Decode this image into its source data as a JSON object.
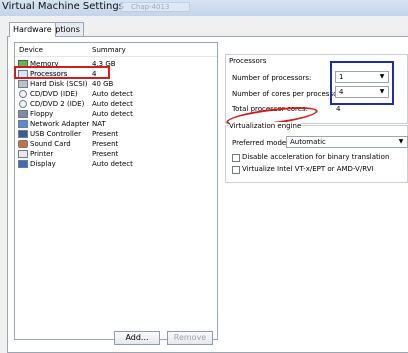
{
  "window": {
    "title": "Virtual Machine Settings",
    "background_tab": "Chap-4013"
  },
  "tabs": [
    "Hardware",
    "Options"
  ],
  "device_list": {
    "headers": [
      "Device",
      "Summary"
    ],
    "rows": [
      {
        "name": "Memory",
        "summary": "4.3 GB",
        "icon": "memory-icon"
      },
      {
        "name": "Processors",
        "summary": "4",
        "icon": "processor-icon"
      },
      {
        "name": "Hard Disk (SCSI)",
        "summary": "40 GB",
        "icon": "hard-disk-icon"
      },
      {
        "name": "CD/DVD (IDE)",
        "summary": "Auto detect",
        "icon": "cd-dvd-icon"
      },
      {
        "name": "CD/DVD 2 (IDE)",
        "summary": "Auto detect",
        "icon": "cd-dvd-icon"
      },
      {
        "name": "Floppy",
        "summary": "Auto detect",
        "icon": "floppy-icon"
      },
      {
        "name": "Network Adapter",
        "summary": "NAT",
        "icon": "network-adapter-icon"
      },
      {
        "name": "USB Controller",
        "summary": "Present",
        "icon": "usb-icon"
      },
      {
        "name": "Sound Card",
        "summary": "Present",
        "icon": "sound-card-icon"
      },
      {
        "name": "Printer",
        "summary": "Present",
        "icon": "printer-icon"
      },
      {
        "name": "Display",
        "summary": "Auto detect",
        "icon": "display-icon"
      }
    ]
  },
  "buttons": {
    "add": "Add...",
    "remove": "Remove"
  },
  "processors": {
    "section_title": "Processors",
    "num_processors_label": "Number of processors:",
    "num_processors_value": "1",
    "cores_label": "Number of cores per processor:",
    "cores_value": "4",
    "total_label": "Total processor cores:",
    "total_value": "4"
  },
  "virtualization": {
    "section_title": "Virtualization engine",
    "preferred_label": "Preferred mode:",
    "preferred_value": "Automatic",
    "check1": "Disable acceleration for binary translation",
    "check2": "Virtualize Intel VT-x/EPT or AMD-V/RVI"
  },
  "colors": {
    "red_annotation": "#d11d1d",
    "blue_annotation": "#1f2ea4",
    "selection": "#e9f1fb"
  }
}
